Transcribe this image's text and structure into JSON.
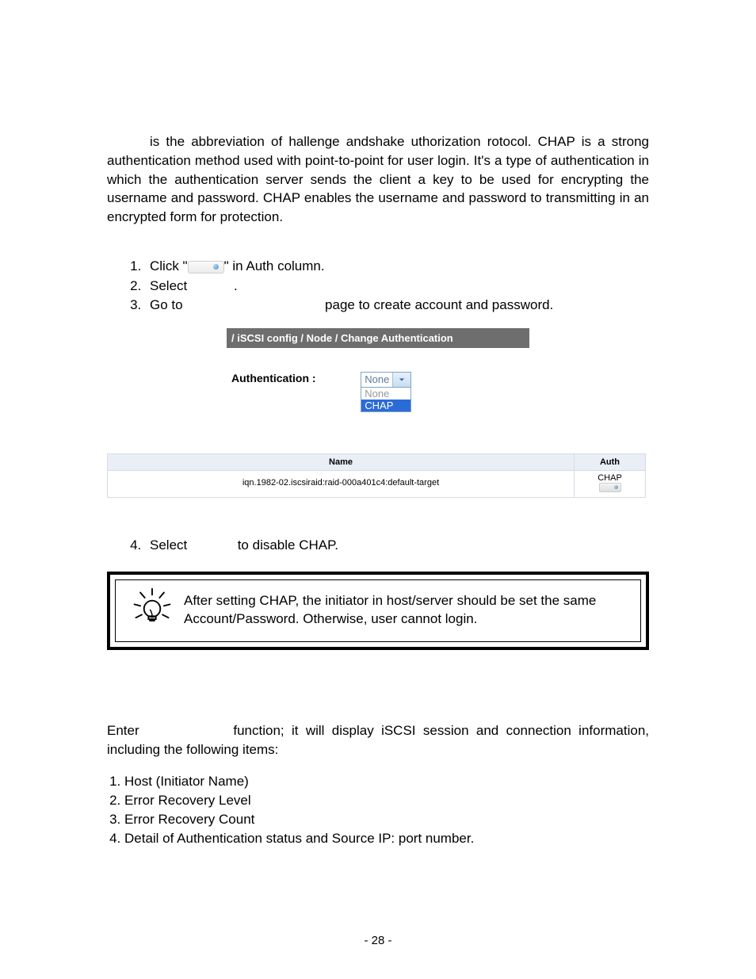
{
  "intro": {
    "part1": " is the abbreviation of  hallenge  andshake  uthorization  rotocol. CHAP is a strong authentication method used with point-to-point for user login. It's a type of authentication in which the authentication server sends the client a key to be used for encrypting the username and password. CHAP enables the username and password to transmitting in an encrypted form for protection."
  },
  "steps_a": {
    "s1_a": "Click \"",
    "s1_b": "\" in Auth column.",
    "s2_a": "Select ",
    "s2_b": ".",
    "s3_a": "Go to ",
    "s3_b": " page to create account and password."
  },
  "breadcrumb": "/ iSCSI config / Node / Change Authentication",
  "auth": {
    "label": "Authentication :",
    "selected": "None",
    "options": [
      "None",
      "CHAP"
    ]
  },
  "table": {
    "col_name": "Name",
    "col_auth": "Auth",
    "row_name": "iqn.1982-02.iscsiraid:raid-000a401c4:default-target",
    "row_auth": "CHAP"
  },
  "step4": {
    "a": "Select ",
    "b": " to disable CHAP."
  },
  "tip": "After setting CHAP, the initiator in host/server should be set the same Account/Password. Otherwise, user cannot login.",
  "session": {
    "intro_a": "Enter ",
    "intro_b": " function; it will display iSCSI session and connection information, including the following items:",
    "items": [
      "Host (Initiator Name)",
      "Error Recovery Level",
      "Error Recovery Count",
      "Detail of Authentication status and Source IP: port number."
    ]
  },
  "page_number": "- 28 -"
}
